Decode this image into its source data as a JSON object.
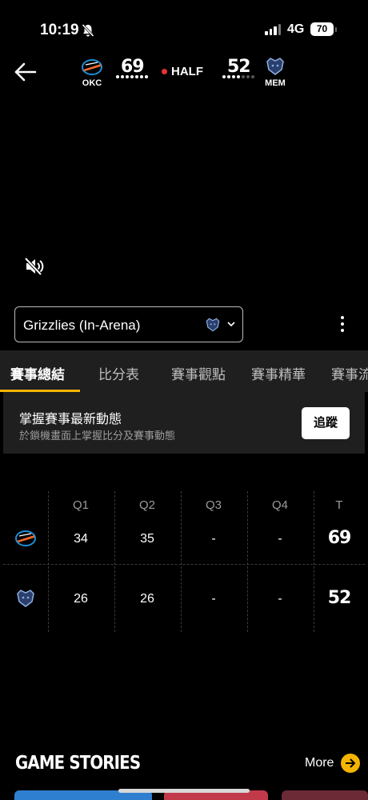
{
  "status_bar": {
    "time": "10:19",
    "network": "4G",
    "battery": "70"
  },
  "header": {
    "away": {
      "abbr": "OKC",
      "score": "69"
    },
    "home": {
      "abbr": "MEM",
      "score": "52"
    },
    "period": "HALF",
    "colors": {
      "live": "#e8322e",
      "okc_blue": "#1d8fd6",
      "okc_orange": "#ef6a2c",
      "mem_navy": "#2b3f6e",
      "mem_light": "#8fb3e3"
    }
  },
  "audio": {
    "selected": "Grizzlies (In-Arena)"
  },
  "tabs": [
    "賽事總結",
    "比分表",
    "賽事觀點",
    "賽事精華",
    "賽事流"
  ],
  "follow": {
    "title": "掌握賽事最新動態",
    "subtitle": "於鎖機畫面上掌握比分及賽事動態",
    "button": "追蹤"
  },
  "box_score": {
    "headers": [
      "Q1",
      "Q2",
      "Q3",
      "Q4",
      "T"
    ],
    "rows": [
      {
        "team": "OKC",
        "q1": "34",
        "q2": "35",
        "q3": "-",
        "q4": "-",
        "total": "69"
      },
      {
        "team": "MEM",
        "q1": "26",
        "q2": "26",
        "q3": "-",
        "q4": "-",
        "total": "52"
      }
    ]
  },
  "stories": {
    "title": "GAME STORIES",
    "more": "More"
  },
  "icons": [
    "bell-slash-icon",
    "back-arrow-icon",
    "speaker-muted-icon",
    "chevron-down-icon",
    "kebab-menu-icon",
    "arrow-right-icon"
  ],
  "accent": "#f5b400"
}
